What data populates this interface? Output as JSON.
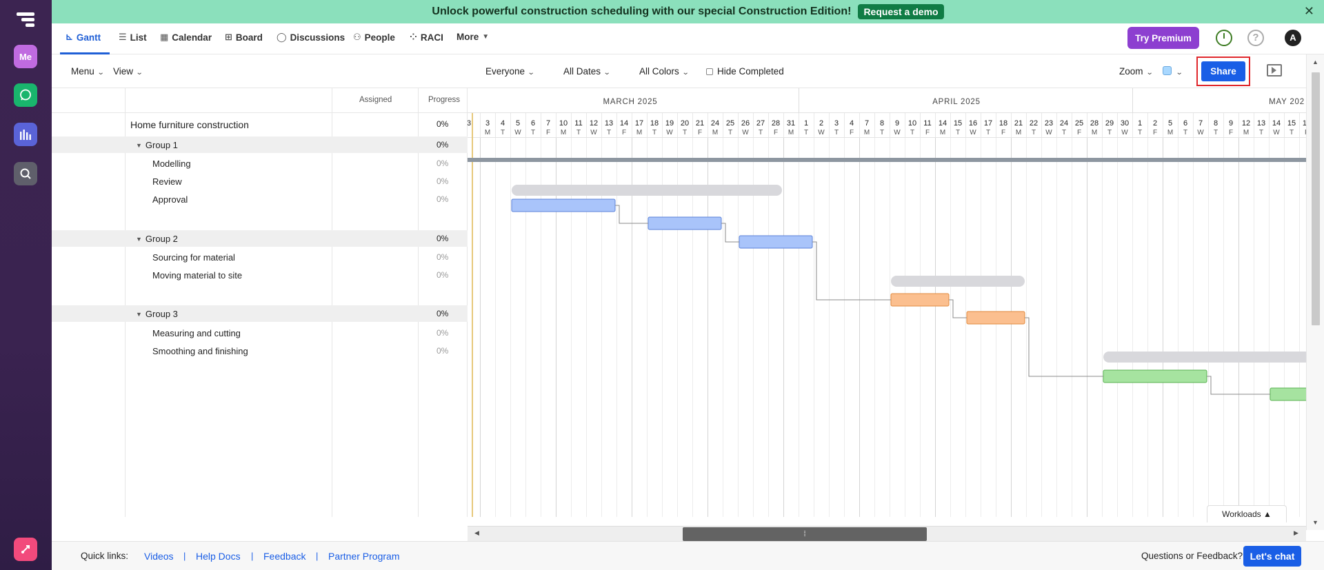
{
  "banner": {
    "text": "Unlock powerful construction scheduling with our special Construction Edition!",
    "cta": "Request a demo",
    "close": "✕"
  },
  "rail": {
    "me_label": "Me"
  },
  "nav": {
    "tabs": [
      {
        "label": "Gantt",
        "icon": "gantt-icon"
      },
      {
        "label": "List",
        "icon": "list-icon"
      },
      {
        "label": "Calendar",
        "icon": "calendar-icon"
      },
      {
        "label": "Board",
        "icon": "board-icon"
      },
      {
        "label": "Discussions",
        "icon": "discussions-icon"
      },
      {
        "label": "People",
        "icon": "people-icon"
      },
      {
        "label": "RACI",
        "icon": "raci-icon"
      },
      {
        "label": "More",
        "icon": "chevron-down-icon"
      }
    ],
    "try_premium": "Try Premium",
    "help": "?",
    "avatar": "A"
  },
  "toolbar": {
    "menu": "Menu",
    "view": "View",
    "everyone": "Everyone",
    "all_dates": "All Dates",
    "all_colors": "All Colors",
    "hide_completed": "Hide Completed",
    "zoom": "Zoom",
    "share": "Share"
  },
  "grid": {
    "headers": {
      "assigned": "Assigned",
      "progress": "Progress"
    },
    "rows": [
      {
        "type": "project",
        "name": "Home furniture construction",
        "progress": "0%"
      },
      {
        "type": "group",
        "name": "Group 1",
        "progress": "0%"
      },
      {
        "type": "task",
        "name": "Modelling",
        "progress": "0%"
      },
      {
        "type": "task",
        "name": "Review",
        "progress": "0%"
      },
      {
        "type": "task",
        "name": "Approval",
        "progress": "0%"
      },
      {
        "type": "group",
        "name": "Group 2",
        "progress": "0%"
      },
      {
        "type": "task",
        "name": "Sourcing for material",
        "progress": "0%"
      },
      {
        "type": "task",
        "name": "Moving material to site",
        "progress": "0%"
      },
      {
        "type": "group",
        "name": "Group 3",
        "progress": "0%"
      },
      {
        "type": "task",
        "name": "Measuring and cutting",
        "progress": "0%"
      },
      {
        "type": "task",
        "name": "Smoothing and finishing",
        "progress": "0%"
      }
    ]
  },
  "timeline": {
    "months": [
      {
        "label": "MARCH 2025",
        "first_day": "2025-03-03"
      },
      {
        "label": "APRIL 2025",
        "first_day": "2025-04-01"
      },
      {
        "label": "MAY 202",
        "first_day": "2025-05-01"
      }
    ],
    "partial_leading_day": "3",
    "days": [
      {
        "d": "3",
        "w": "M"
      },
      {
        "d": "4",
        "w": "T"
      },
      {
        "d": "5",
        "w": "W"
      },
      {
        "d": "6",
        "w": "T"
      },
      {
        "d": "7",
        "w": "F"
      },
      {
        "d": "10",
        "w": "M"
      },
      {
        "d": "11",
        "w": "T"
      },
      {
        "d": "12",
        "w": "W"
      },
      {
        "d": "13",
        "w": "T"
      },
      {
        "d": "14",
        "w": "F"
      },
      {
        "d": "17",
        "w": "M"
      },
      {
        "d": "18",
        "w": "T"
      },
      {
        "d": "19",
        "w": "W"
      },
      {
        "d": "20",
        "w": "T"
      },
      {
        "d": "21",
        "w": "F"
      },
      {
        "d": "24",
        "w": "M"
      },
      {
        "d": "25",
        "w": "T"
      },
      {
        "d": "26",
        "w": "W"
      },
      {
        "d": "27",
        "w": "T"
      },
      {
        "d": "28",
        "w": "F"
      },
      {
        "d": "31",
        "w": "M"
      },
      {
        "d": "1",
        "w": "T"
      },
      {
        "d": "2",
        "w": "W"
      },
      {
        "d": "3",
        "w": "T"
      },
      {
        "d": "4",
        "w": "F"
      },
      {
        "d": "7",
        "w": "M"
      },
      {
        "d": "8",
        "w": "T"
      },
      {
        "d": "9",
        "w": "W"
      },
      {
        "d": "10",
        "w": "T"
      },
      {
        "d": "11",
        "w": "F"
      },
      {
        "d": "14",
        "w": "M"
      },
      {
        "d": "15",
        "w": "T"
      },
      {
        "d": "16",
        "w": "W"
      },
      {
        "d": "17",
        "w": "T"
      },
      {
        "d": "18",
        "w": "F"
      },
      {
        "d": "21",
        "w": "M"
      },
      {
        "d": "22",
        "w": "T"
      },
      {
        "d": "23",
        "w": "W"
      },
      {
        "d": "24",
        "w": "T"
      },
      {
        "d": "25",
        "w": "F"
      },
      {
        "d": "28",
        "w": "M"
      },
      {
        "d": "29",
        "w": "T"
      },
      {
        "d": "30",
        "w": "W"
      },
      {
        "d": "1",
        "w": "T"
      },
      {
        "d": "2",
        "w": "F"
      },
      {
        "d": "5",
        "w": "M"
      },
      {
        "d": "6",
        "w": "T"
      },
      {
        "d": "7",
        "w": "W"
      },
      {
        "d": "8",
        "w": "T"
      },
      {
        "d": "9",
        "w": "F"
      },
      {
        "d": "12",
        "w": "M"
      },
      {
        "d": "13",
        "w": "T"
      },
      {
        "d": "14",
        "w": "W"
      },
      {
        "d": "15",
        "w": "T"
      },
      {
        "d": "16",
        "w": "F"
      }
    ],
    "bars": [
      {
        "name": "Group 1",
        "type": "summary",
        "start": "2025-03-05",
        "end": "2025-03-28"
      },
      {
        "name": "Modelling",
        "type": "task",
        "color": "blue",
        "start": "2025-03-05",
        "end": "2025-03-13"
      },
      {
        "name": "Review",
        "type": "task",
        "color": "blue",
        "start": "2025-03-18",
        "end": "2025-03-24"
      },
      {
        "name": "Approval",
        "type": "task",
        "color": "blue",
        "start": "2025-03-26",
        "end": "2025-04-01"
      },
      {
        "name": "Group 2",
        "type": "summary",
        "start": "2025-04-09",
        "end": "2025-04-21"
      },
      {
        "name": "Sourcing for material",
        "type": "task",
        "color": "orange",
        "start": "2025-04-09",
        "end": "2025-04-14"
      },
      {
        "name": "Moving material to site",
        "type": "task",
        "color": "orange",
        "start": "2025-04-16",
        "end": "2025-04-21"
      },
      {
        "name": "Group 3",
        "type": "summary",
        "start": "2025-04-29",
        "end": "2025-05-16"
      },
      {
        "name": "Measuring and cutting",
        "type": "task",
        "color": "green",
        "start": "2025-04-29",
        "end": "2025-05-07"
      },
      {
        "name": "Smoothing and finishing",
        "type": "task",
        "color": "green",
        "start": "2025-05-14",
        "end": "2025-05-16"
      }
    ],
    "colors": {
      "blue": "#a9c4fa",
      "orange": "#fbbf8f",
      "green": "#a6e3a0",
      "summary": "#d8d8dc",
      "project": "#8d96a0"
    }
  },
  "workloads": "Workloads ▲",
  "footer": {
    "label": "Quick links:",
    "links": [
      "Videos",
      "Help Docs",
      "Feedback",
      "Partner Program"
    ],
    "questions": "Questions or Feedback?",
    "chat": "Let's chat"
  }
}
